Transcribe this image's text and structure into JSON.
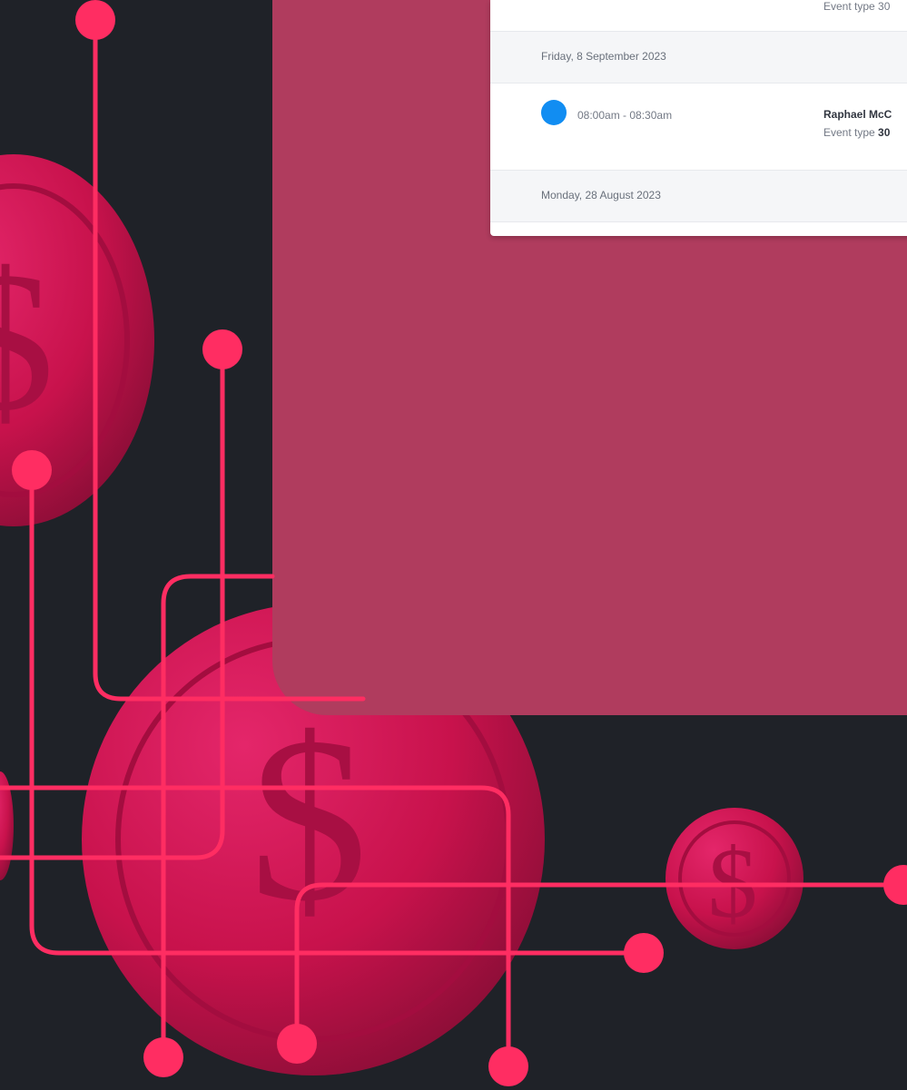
{
  "calendar": {
    "top_fragment": "Event type 30",
    "groups": [
      {
        "date": "Friday, 8 September 2023",
        "event": {
          "time": "08:00am - 08:30am",
          "name": "Raphael McC",
          "type_label": "Event type",
          "type_value": "30"
        }
      },
      {
        "date": "Monday, 28 August 2023"
      }
    ]
  },
  "colors": {
    "background": "#1f2228",
    "panel": "#b03c5e",
    "coin": "#c8124c",
    "circuit": "#ff2d62",
    "event_dot": "#118df2"
  },
  "icons": {
    "coin": "dollar-coin-icon",
    "event_marker": "blue-dot-icon"
  }
}
